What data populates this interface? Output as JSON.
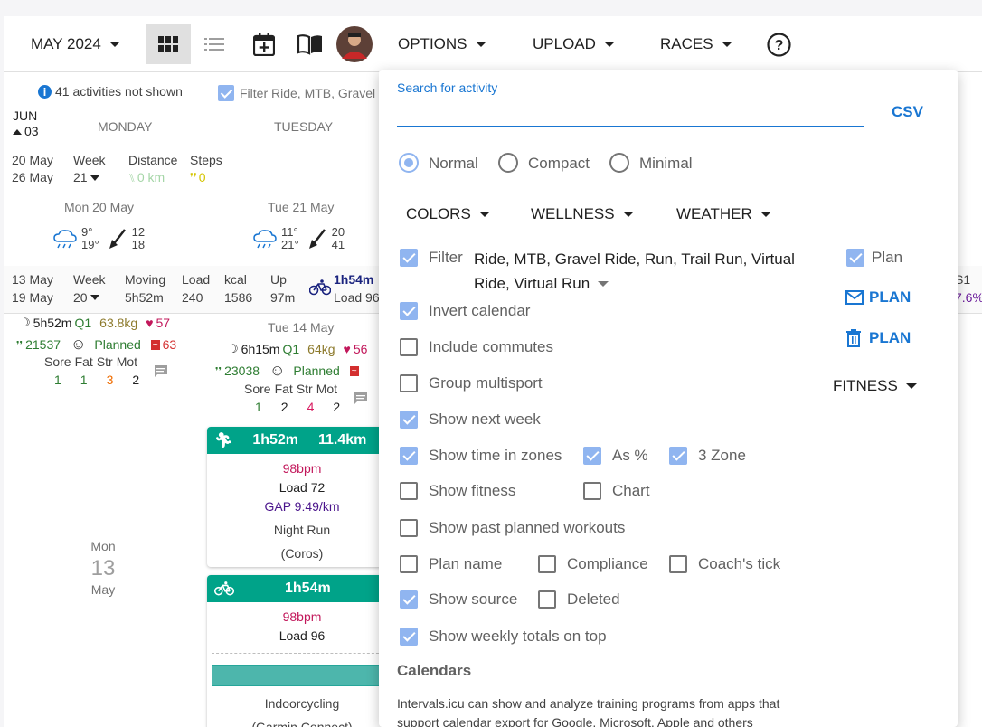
{
  "topbar": {
    "month": "MAY 2024",
    "options": "OPTIONS",
    "upload": "UPLOAD",
    "races": "RACES"
  },
  "calendar": {
    "activities_hidden": "41 activities not shown",
    "filter_label": "Filter Ride, MTB, Gravel",
    "jump_month": "JUN",
    "jump_day": "03",
    "day_headers": [
      "MONDAY",
      "TUESDAY"
    ],
    "week1": {
      "dates_from": "20 May",
      "dates_to": "26 May",
      "week_label": "Week",
      "week_num": "21",
      "distance_label": "Distance",
      "distance": "0 km",
      "steps_label": "Steps",
      "steps": "0"
    },
    "days_top": [
      {
        "label": "Mon 20 May",
        "temp_hi": "9°",
        "temp_lo": "19°",
        "wind1": "12",
        "wind2": "18"
      },
      {
        "label": "Tue 21 May",
        "temp_hi": "11°",
        "temp_lo": "21°",
        "wind1": "20",
        "wind2": "41"
      }
    ],
    "week2": {
      "dates_from": "13 May",
      "dates_to": "19 May",
      "week_label": "Week",
      "week_num": "20",
      "moving_label": "Moving",
      "moving": "5h52m",
      "load_label": "Load",
      "load": "240",
      "kcal_label": "kcal",
      "kcal": "1586",
      "up_label": "Up",
      "up": "97m",
      "ride_time": "1h54m",
      "ride_load": "Load 96",
      "partial_s": "S1",
      "partial_pct": "7.6%"
    },
    "monday_wellness": {
      "sleep": "5h52m",
      "sleep_q": "Q1",
      "weight": "63.8kg",
      "hr": "57",
      "steps": "21537",
      "mood": "Planned",
      "hrv": "63",
      "metrics_labels": [
        "Sore",
        "Fat",
        "Str",
        "Mot"
      ],
      "metrics_values": [
        "1",
        "1",
        "3",
        "2"
      ]
    },
    "tuesday": {
      "label": "Tue 14 May",
      "sleep": "6h15m",
      "sleep_q": "Q1",
      "weight": "64kg",
      "hr": "56",
      "steps": "23038",
      "mood": "Planned",
      "metrics_labels": [
        "Sore",
        "Fat",
        "Str",
        "Mot"
      ],
      "metrics_values": [
        "1",
        "2",
        "4",
        "2"
      ]
    },
    "monday_label": {
      "dow": "Mon",
      "day": "13",
      "month": "May"
    },
    "run_card": {
      "time": "1h52m",
      "distance": "11.4km",
      "hr": "98bpm",
      "load": "Load 72",
      "gap": "GAP 9:49/km",
      "name": "Night Run",
      "source": "(Coros)"
    },
    "ride_card": {
      "time": "1h54m",
      "hr": "98bpm",
      "load": "Load 96",
      "name": "Indoorcycling",
      "source": "(Garmin Connect)"
    }
  },
  "popup": {
    "search_label": "Search for activity",
    "search_value": "",
    "csv": "CSV",
    "modes": [
      "Normal",
      "Compact",
      "Minimal"
    ],
    "dropdowns": [
      "COLORS",
      "WELLNESS",
      "WEATHER"
    ],
    "filter_label": "Filter",
    "filter_types_line1": "Ride, MTB, Gravel Ride, Run, Trail Run, Virtual",
    "filter_types_line2": "Ride, Virtual Run",
    "plan_label": "Plan",
    "plan_email": "PLAN",
    "plan_delete": "PLAN",
    "fitness": "FITNESS",
    "options": {
      "invert": "Invert calendar",
      "commutes": "Include commutes",
      "multisport": "Group multisport",
      "next_week": "Show next week",
      "time_in_zones": "Show time in zones",
      "as_pct": "As %",
      "three_zone": "3 Zone",
      "show_fitness": "Show fitness",
      "chart": "Chart",
      "past_planned": "Show past planned workouts",
      "plan_name": "Plan name",
      "compliance": "Compliance",
      "coach_tick": "Coach's tick",
      "show_source": "Show source",
      "deleted": "Deleted",
      "weekly_totals": "Show weekly totals on top"
    },
    "calendars_heading": "Calendars",
    "calendars_text1": "Intervals.icu can show and analyze training programs from apps that",
    "calendars_text2": "support calendar export for Google, Microsoft, Apple and others"
  },
  "colors": {
    "accent": "#1976d2",
    "card_head": "#00a389",
    "checkbox_on": "#90b5f0",
    "hr_red": "#c2185b",
    "gap_purple": "#4a148c"
  }
}
